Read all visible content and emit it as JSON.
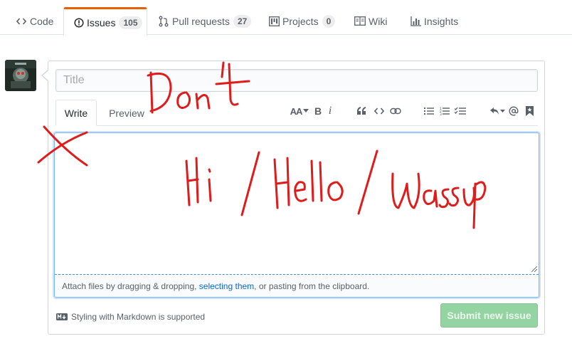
{
  "nav": {
    "tabs": [
      {
        "label": "Code",
        "icon": "code-icon"
      },
      {
        "label": "Issues",
        "count": "105",
        "icon": "issue-opened-icon"
      },
      {
        "label": "Pull requests",
        "count": "27",
        "icon": "git-pull-request-icon"
      },
      {
        "label": "Projects",
        "count": "0",
        "icon": "project-icon"
      },
      {
        "label": "Wiki",
        "icon": "book-icon"
      },
      {
        "label": "Insights",
        "icon": "graph-icon"
      }
    ]
  },
  "form": {
    "title_placeholder": "Title",
    "write_tab": "Write",
    "preview_tab": "Preview",
    "drag_text_before": "Attach files by dragging & dropping, ",
    "drag_link": "selecting them",
    "drag_text_after": ", or pasting from the clipboard.",
    "markdown_note": "Styling with Markdown is supported",
    "submit_label": "Submit new issue"
  },
  "toolbar": {
    "header": "AA",
    "bold": "B",
    "italic": "i"
  },
  "annotations": {
    "top": "Don't",
    "body": "Hi / Hello / Wassup"
  },
  "colors": {
    "accent_tab": "#e36209",
    "link": "#0366d6",
    "submit_disabled": "#94d3a2",
    "annotation": "#e01b1b"
  }
}
